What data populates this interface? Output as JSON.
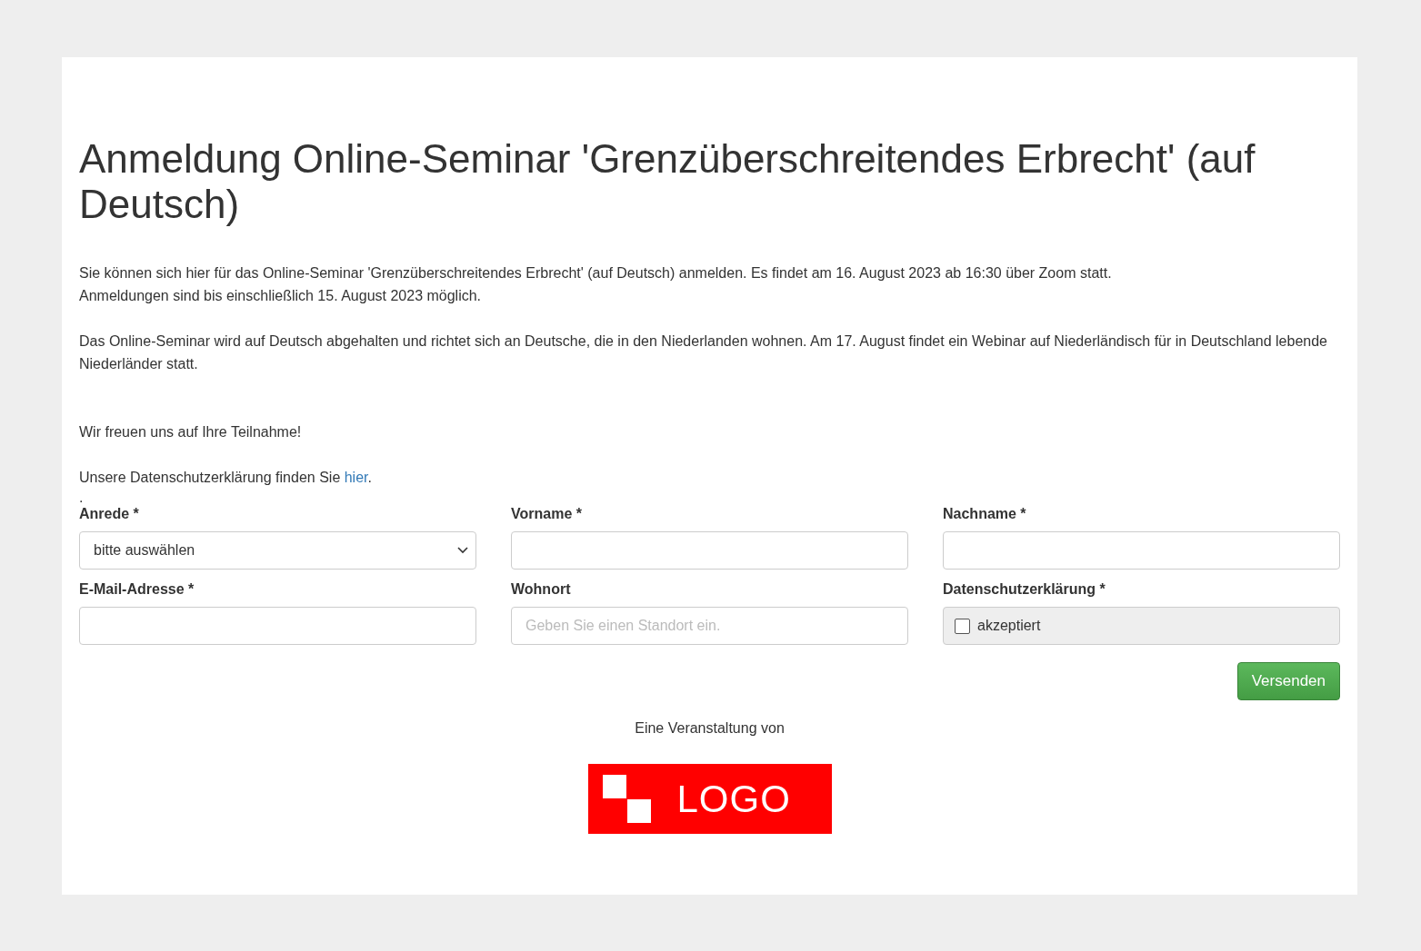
{
  "title": "Anmeldung Online-Seminar 'Grenzüberschreitendes Erbrecht' (auf Deutsch)",
  "paragraphs": [
    "Sie können sich hier für das Online-Seminar 'Grenzüberschreitendes Erbrecht' (auf Deutsch) anmelden. Es findet am 16. August 2023 ab 16:30  über Zoom statt.",
    "Anmeldungen sind bis einschließlich 15. August 2023 möglich.",
    "Das Online-Seminar wird auf Deutsch abgehalten und richtet sich an Deutsche, die in den Niederlanden wohnen. Am 17. August findet ein Webinar auf Niederländisch für in Deutschland lebende Niederländer statt.",
    "Wir freuen uns auf Ihre Teilnahme!"
  ],
  "privacy_note": {
    "text": "Unsere Datenschutzerklärung finden Sie",
    "link": "hier",
    "end": "."
  },
  "dot": ".",
  "fields": [
    {
      "kind": "select",
      "label": "Anrede *",
      "value": "bitte auswählen"
    },
    {
      "kind": "text",
      "label": "Vorname *"
    },
    {
      "kind": "text",
      "label": "Nachname *"
    },
    {
      "kind": "text",
      "label": "E-Mail-Adresse *"
    },
    {
      "kind": "text",
      "label": "Wohnort",
      "placeholder": "Geben Sie einen Standort ein."
    },
    {
      "kind": "checkbox",
      "label": "Datenschutzerklärung *",
      "option": "akzeptiert",
      "checked": false
    }
  ],
  "submit": "Versenden",
  "organizer": "Eine Veranstaltung von",
  "logo": {
    "text": "LOGO"
  }
}
